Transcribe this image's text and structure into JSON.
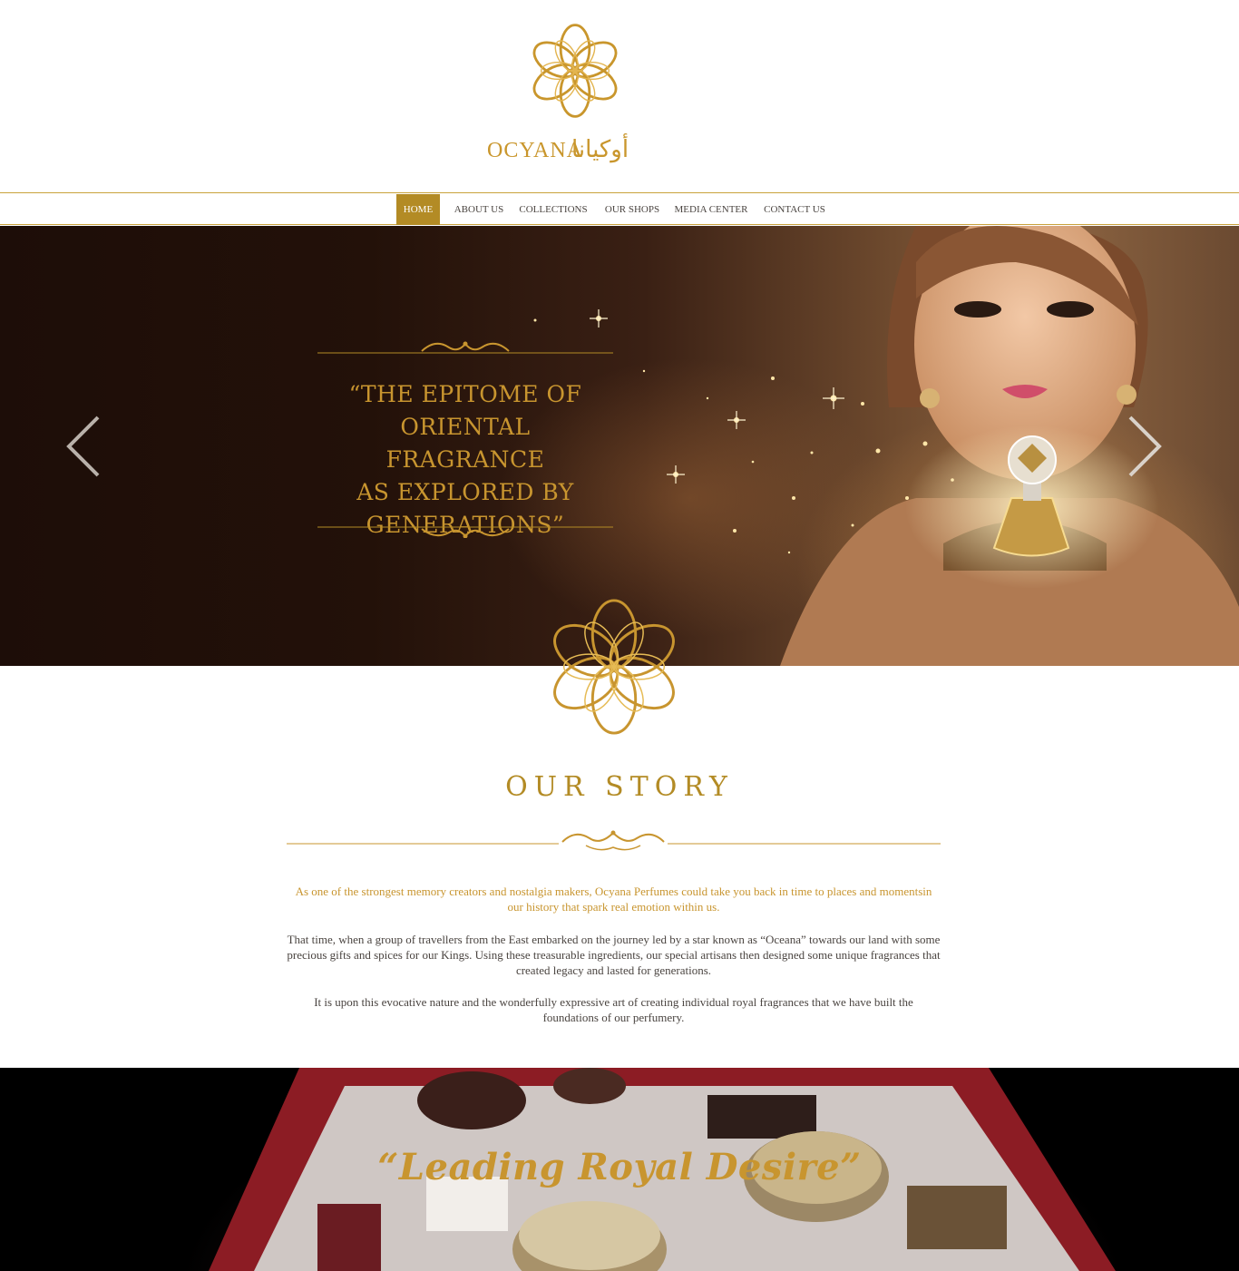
{
  "brand": {
    "name": "OCYANA",
    "arabic": "أوكيانا"
  },
  "nav": {
    "items": [
      {
        "label": "HOME",
        "active": true
      },
      {
        "label": "ABOUT  US",
        "active": false
      },
      {
        "label": "COLLECTIONS",
        "active": false
      },
      {
        "label": "OUR SHOPS",
        "active": false
      },
      {
        "label": "MEDIA CENTER",
        "active": false
      },
      {
        "label": "CONTACT US",
        "active": false
      }
    ]
  },
  "hero": {
    "quote_lines": [
      "“THE EPITOME OF",
      "ORIENTAL FRAGRANCE",
      "AS EXPLORED BY",
      "GENERATIONS”"
    ],
    "prev_icon": "chevron-left-icon",
    "next_icon": "chevron-right-icon"
  },
  "story": {
    "title": "OUR STORY",
    "intro": "As one of the strongest memory creators and nostalgia makers, Ocyana Perfumes could take you back in time to places and momentsin our history that spark real emotion within us.",
    "paragraph_1": "That time, when a group of travellers from the East embarked on the journey led by a star known as “Oceana” towards our land with some precious gifts and spices for our Kings. Using these treasurable ingredients, our special artisans then designed some unique fragrances that created legacy and lasted for generations.",
    "paragraph_2": "It is upon this evocative nature and the wonderfully expressive art of creating individual royal fragrances that we have built the foundations of our perfumery."
  },
  "banner": {
    "quote": "“Leading Royal Desire”"
  },
  "colors": {
    "gold": "#c8952f",
    "nav_active": "#b38b25",
    "text": "#4a4440"
  }
}
